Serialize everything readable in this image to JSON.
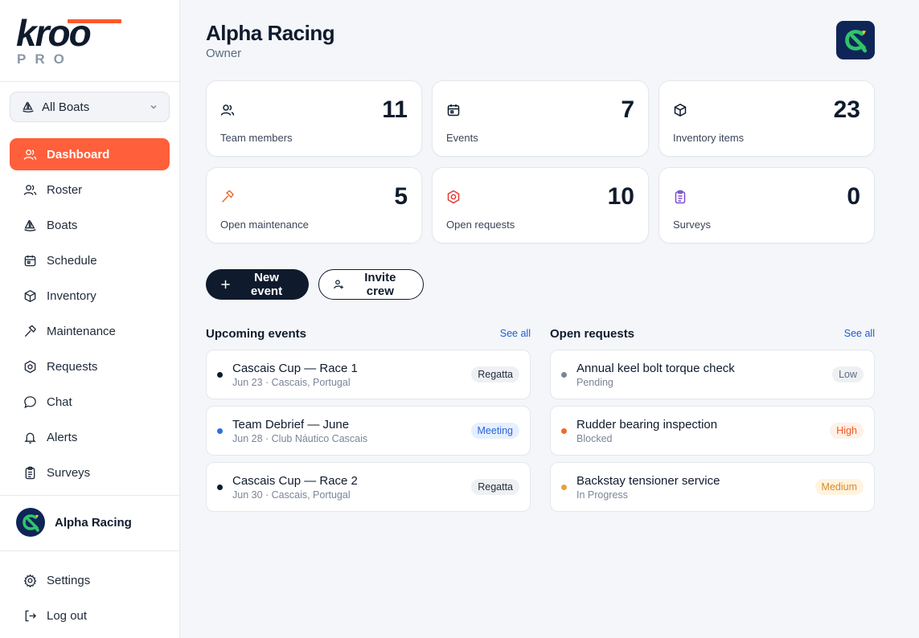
{
  "brand": {
    "logo_word": "kroo",
    "logo_sub": "PRO",
    "accent": "#ff5f3a",
    "navy": "#0f1b2d"
  },
  "sidebar": {
    "boat_selector": {
      "value": "All Boats",
      "icon": "sailboat-icon"
    },
    "items": [
      {
        "label": "Dashboard",
        "icon": "users-icon",
        "active": true
      },
      {
        "label": "Roster",
        "icon": "users-icon"
      },
      {
        "label": "Boats",
        "icon": "sailboat-icon"
      },
      {
        "label": "Schedule",
        "icon": "calendar-icon"
      },
      {
        "label": "Inventory",
        "icon": "box-icon"
      },
      {
        "label": "Maintenance",
        "icon": "hammer-icon"
      },
      {
        "label": "Requests",
        "icon": "hexagon-icon"
      },
      {
        "label": "Chat",
        "icon": "chat-icon"
      },
      {
        "label": "Alerts",
        "icon": "bell-icon"
      },
      {
        "label": "Surveys",
        "icon": "clipboard-icon"
      }
    ],
    "team": {
      "name": "Alpha Racing"
    },
    "bottom": [
      {
        "label": "Settings",
        "icon": "gear-icon"
      },
      {
        "label": "Log out",
        "icon": "logout-icon"
      }
    ]
  },
  "header": {
    "title": "Alpha Racing",
    "role": "Owner"
  },
  "stats": [
    {
      "value": "11",
      "label": "Team members",
      "icon": "users-icon",
      "color": "#0f1b2d"
    },
    {
      "value": "7",
      "label": "Events",
      "icon": "calendar-icon",
      "color": "#0f1b2d"
    },
    {
      "value": "23",
      "label": "Inventory items",
      "icon": "box-icon",
      "color": "#0f1b2d"
    },
    {
      "value": "5",
      "label": "Open maintenance",
      "icon": "hammer-icon",
      "color": "#ef6a2e"
    },
    {
      "value": "10",
      "label": "Open requests",
      "icon": "hexagon-icon",
      "color": "#e53935"
    },
    {
      "value": "0",
      "label": "Surveys",
      "icon": "clipboard-icon",
      "color": "#7c4dcc"
    }
  ],
  "actions": {
    "new_event": "New event",
    "invite_crew": "Invite crew"
  },
  "upcoming": {
    "title": "Upcoming events",
    "see_all": "See all",
    "items": [
      {
        "title": "Cascais Cup — Race 1",
        "sub": "Jun 23 · Cascais, Portugal",
        "tag": "Regatta",
        "dot": "#0f1b2d",
        "tag_bg": "#eef0f3",
        "tag_fg": "#1f2a3a"
      },
      {
        "title": "Team Debrief — June",
        "sub": "Jun 28 · Club Náutico Cascais",
        "tag": "Meeting",
        "dot": "#2f6fe0",
        "tag_bg": "#e6efff",
        "tag_fg": "#2b63d9"
      },
      {
        "title": "Cascais Cup — Race 2",
        "sub": "Jun 30 · Cascais, Portugal",
        "tag": "Regatta",
        "dot": "#0f1b2d",
        "tag_bg": "#eef0f3",
        "tag_fg": "#1f2a3a"
      }
    ]
  },
  "requests": {
    "title": "Open requests",
    "see_all": "See all",
    "items": [
      {
        "title": "Annual keel bolt torque check",
        "sub": "Pending",
        "tag": "Low",
        "dot": "#7a8598",
        "tag_bg": "#eef0f3",
        "tag_fg": "#5d6b80"
      },
      {
        "title": "Rudder bearing inspection",
        "sub": "Blocked",
        "tag": "High",
        "dot": "#f26a2e",
        "tag_bg": "#fff0e8",
        "tag_fg": "#ef5a1e"
      },
      {
        "title": "Backstay tensioner service",
        "sub": "In Progress",
        "tag": "Medium",
        "dot": "#e8a13a",
        "tag_bg": "#fff4e0",
        "tag_fg": "#d9892a"
      }
    ]
  }
}
